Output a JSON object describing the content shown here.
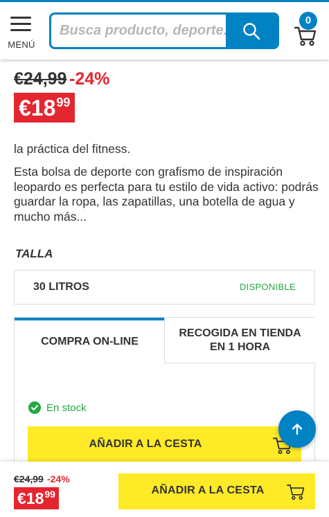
{
  "header": {
    "menu_label": "MENÚ",
    "search_placeholder": "Busca producto, deporte...",
    "cart_count": "0"
  },
  "price": {
    "old": "€24,99",
    "discount": "-24%",
    "current_int": "€18",
    "current_dec": "99"
  },
  "description": {
    "line1": "la práctica del fitness.",
    "paragraph": "Esta bolsa de deporte con grafismo de inspiración leopardo es perfecta para tu estilo de vida activo: podrás guardar la ropa, las zapatillas, una botella de agua y mucho más..."
  },
  "size": {
    "label": "TALLA",
    "option": "30 LITROS",
    "status": "DISPONIBLE"
  },
  "tabs": [
    {
      "label": "COMPRA ON-LINE",
      "active": true
    },
    {
      "label": "RECOGIDA EN TIENDA EN 1 HORA",
      "active": false
    }
  ],
  "stock": {
    "text": "En stock"
  },
  "add_to_cart": {
    "label": "AÑADIR A LA CESTA"
  },
  "sticky_bar": {
    "old": "€24,99",
    "discount": "-24%",
    "current_int": "€18",
    "current_dec": "99",
    "add_label": "AÑADIR A LA CESTA"
  },
  "colors": {
    "brand_blue": "#0082c3",
    "promo_red": "#e3262f",
    "cta_yellow": "#ffea28",
    "stock_green": "#23a942"
  },
  "icons": {
    "menu": "hamburger-icon",
    "search": "search-icon",
    "cart": "cart-icon",
    "check": "check-circle-icon",
    "scroll_top": "arrow-up-icon"
  }
}
